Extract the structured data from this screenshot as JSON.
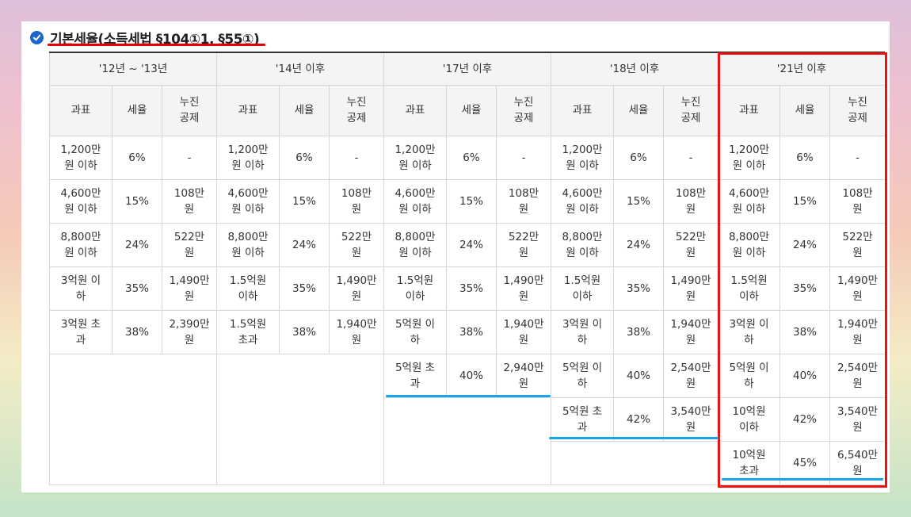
{
  "heading": {
    "title": "기본세율(소득세법 §104①1, §55①)",
    "icon": "check-circle-icon",
    "icon_color": "#1e66c9"
  },
  "annotation_colors": {
    "highlight_box": "#ee1111",
    "underline_red": "#e00000",
    "underline_blue": "#1aa3e6"
  },
  "periods": [
    "'12년 ~ '13년",
    "'14년 이후",
    "'17년 이후",
    "'18년 이후",
    "'21년 이후"
  ],
  "subheaders": {
    "base": "과표",
    "rate": "세율",
    "deduction": "누진\n공제"
  },
  "groups": [
    {
      "rows": [
        [
          "1,200만\n원 이하",
          "6%",
          "-"
        ],
        [
          "4,600만\n원 이하",
          "15%",
          "108만\n원"
        ],
        [
          "8,800만\n원 이하",
          "24%",
          "522만\n원"
        ],
        [
          "3억원 이\n하",
          "35%",
          "1,490만\n원"
        ],
        [
          "3억원 초\n과",
          "38%",
          "2,390만\n원"
        ]
      ]
    },
    {
      "rows": [
        [
          "1,200만\n원 이하",
          "6%",
          "-"
        ],
        [
          "4,600만\n원 이하",
          "15%",
          "108만\n원"
        ],
        [
          "8,800만\n원 이하",
          "24%",
          "522만\n원"
        ],
        [
          "1.5억원\n이하",
          "35%",
          "1,490만\n원"
        ],
        [
          "1.5억원\n초과",
          "38%",
          "1,940만\n원"
        ]
      ]
    },
    {
      "rows": [
        [
          "1,200만\n원 이하",
          "6%",
          "-"
        ],
        [
          "4,600만\n원 이하",
          "15%",
          "108만\n원"
        ],
        [
          "8,800만\n원 이하",
          "24%",
          "522만\n원"
        ],
        [
          "1.5억원\n이하",
          "35%",
          "1,490만\n원"
        ],
        [
          "5억원 이\n하",
          "38%",
          "1,940만\n원"
        ],
        [
          "5억원 초\n과",
          "40%",
          "2,940만\n원"
        ]
      ]
    },
    {
      "rows": [
        [
          "1,200만\n원 이하",
          "6%",
          "-"
        ],
        [
          "4,600만\n원 이하",
          "15%",
          "108만\n원"
        ],
        [
          "8,800만\n원 이하",
          "24%",
          "522만\n원"
        ],
        [
          "1.5억원\n이하",
          "35%",
          "1,490만\n원"
        ],
        [
          "3억원 이\n하",
          "38%",
          "1,940만\n원"
        ],
        [
          "5억원 이\n하",
          "40%",
          "2,540만\n원"
        ],
        [
          "5억원 초\n과",
          "42%",
          "3,540만\n원"
        ]
      ]
    },
    {
      "rows": [
        [
          "1,200만\n원 이하",
          "6%",
          "-"
        ],
        [
          "4,600만\n원 이하",
          "15%",
          "108만\n원"
        ],
        [
          "8,800만\n원 이하",
          "24%",
          "522만\n원"
        ],
        [
          "1.5억원\n이하",
          "35%",
          "1,490만\n원"
        ],
        [
          "3억원 이\n하",
          "38%",
          "1,940만\n원"
        ],
        [
          "5억원 이\n하",
          "40%",
          "2,540만\n원"
        ],
        [
          "10억원\n이하",
          "42%",
          "3,540만\n원"
        ],
        [
          "10억원\n초과",
          "45%",
          "6,540만\n원"
        ]
      ]
    }
  ]
}
